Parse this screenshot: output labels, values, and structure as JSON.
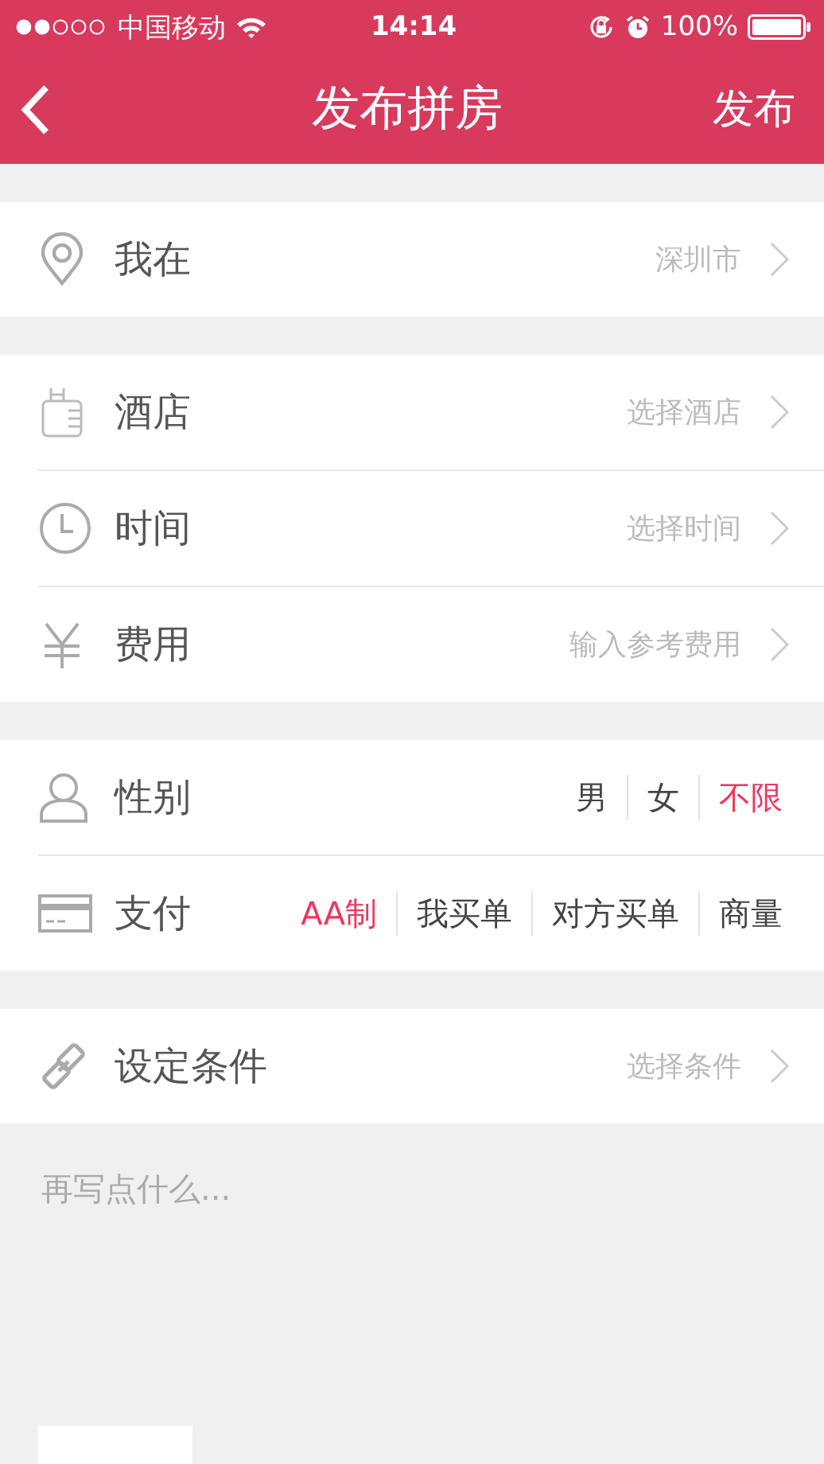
{
  "status_bar": {
    "carrier": "中国移动",
    "time": "14:14",
    "battery": "100%"
  },
  "nav": {
    "title": "发布拼房",
    "action": "发布"
  },
  "groups": [
    [
      {
        "kind": "link",
        "label": "我在",
        "value": "深圳市"
      }
    ],
    [
      {
        "kind": "link",
        "label": "酒店",
        "value": "选择酒店"
      },
      {
        "kind": "link",
        "label": "时间",
        "value": "选择时间"
      },
      {
        "kind": "link",
        "label": "费用",
        "value": "输入参考费用"
      }
    ],
    [
      {
        "kind": "choice",
        "label": "性别",
        "options": [
          {
            "label": "男",
            "selected": false
          },
          {
            "label": "女",
            "selected": false
          },
          {
            "label": "不限",
            "selected": true
          }
        ]
      },
      {
        "kind": "choice",
        "label": "支付",
        "options": [
          {
            "label": "AA制",
            "selected": true
          },
          {
            "label": "我买单",
            "selected": false
          },
          {
            "label": "对方买单",
            "selected": false
          },
          {
            "label": "商量",
            "selected": false
          }
        ]
      }
    ],
    [
      {
        "kind": "link",
        "label": "设定条件",
        "value": "选择条件"
      }
    ]
  ],
  "note": {
    "placeholder": "再写点什么..."
  }
}
